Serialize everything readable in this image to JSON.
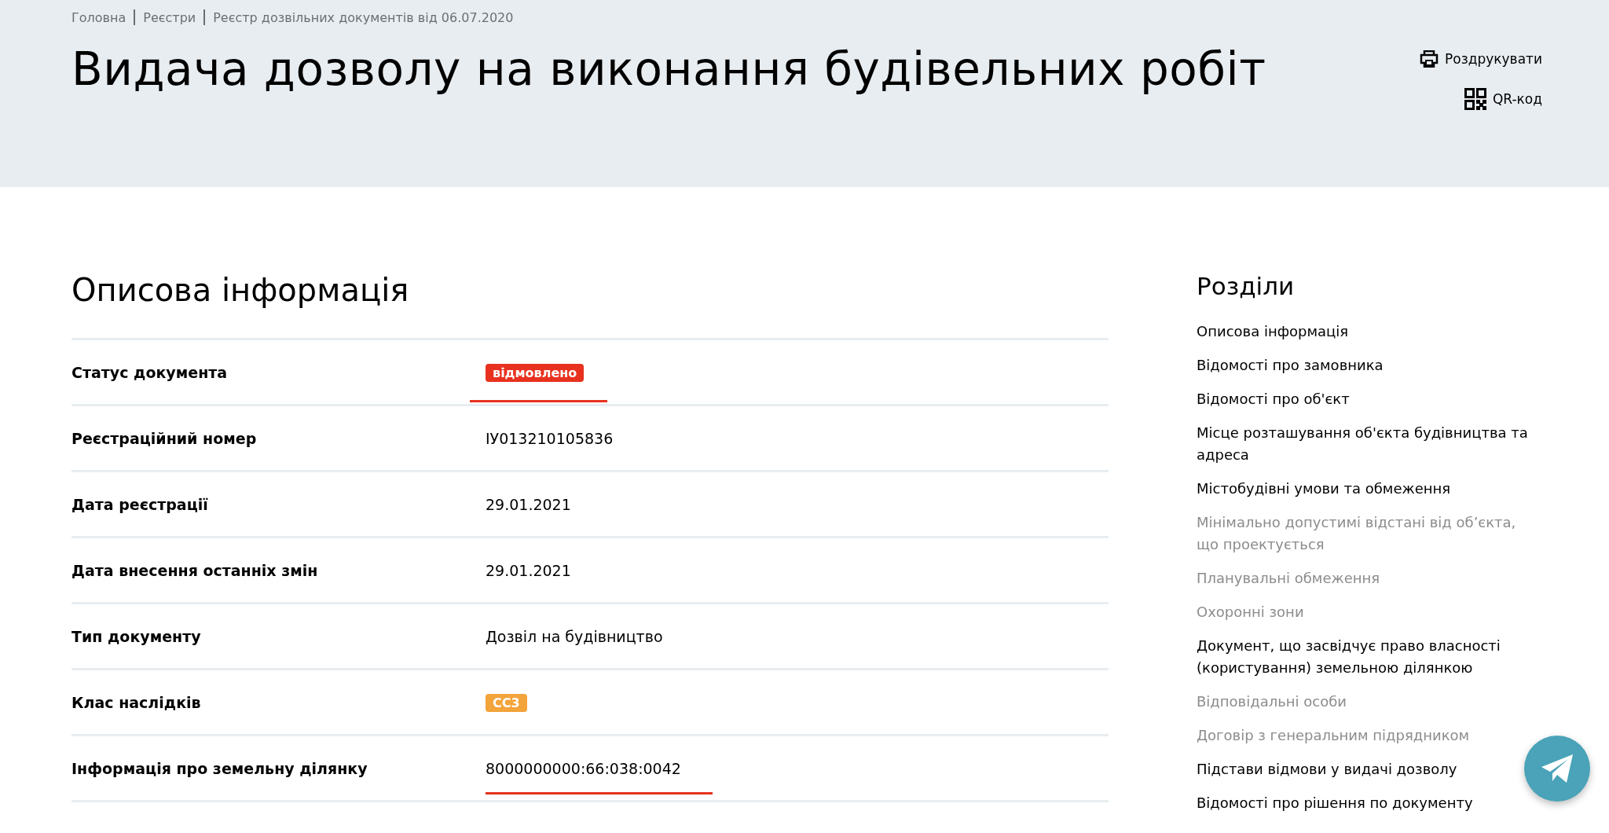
{
  "breadcrumbs": [
    "Головна",
    "Реєстри",
    "Реєстр дозвільних документів від 06.07.2020"
  ],
  "title": "Видача дозволу на виконання будівельних робіт",
  "actions": [
    {
      "kind": "print",
      "label": "Роздрукувати"
    },
    {
      "kind": "qr",
      "label": "QR-код"
    }
  ],
  "section": {
    "title": "Описова інформація",
    "rows": [
      {
        "label": "Статус документа",
        "kind": "badge",
        "value": "відмовлено",
        "color": "#e8321f",
        "underlined": true
      },
      {
        "label": "Реєстраційний номер",
        "kind": "text",
        "value": "ІУ013210105836",
        "underlined": false
      },
      {
        "label": "Дата реєстрації",
        "kind": "text",
        "value": "29.01.2021",
        "underlined": false
      },
      {
        "label": "Дата внесення останніх змін",
        "kind": "text",
        "value": "29.01.2021",
        "underlined": false
      },
      {
        "label": "Тип документу",
        "kind": "text",
        "value": "Дозвіл на будівництво",
        "underlined": false
      },
      {
        "label": "Клас наслідків",
        "kind": "badge",
        "value": "СС3",
        "color": "#f3a43b",
        "underlined": false
      },
      {
        "label": "Інформація про земельну ділянку",
        "kind": "text",
        "value": "8000000000:66:038:0042",
        "underlined": true
      }
    ]
  },
  "sidebar": {
    "title": "Розділи",
    "items": [
      {
        "label": "Описова інформація",
        "disabled": false
      },
      {
        "label": "Відомості про замовника",
        "disabled": false
      },
      {
        "label": "Відомості про об'єкт",
        "disabled": false
      },
      {
        "label": "Місце розташування об'єкта будівництва та адреса",
        "disabled": false
      },
      {
        "label": "Містобудівні умови та обмеження",
        "disabled": false
      },
      {
        "label": "Мінімально допустимі відстані від об’єкта, що проектується",
        "disabled": true
      },
      {
        "label": "Планувальні обмеження",
        "disabled": true
      },
      {
        "label": "Охоронні зони",
        "disabled": true
      },
      {
        "label": "Документ, що засвідчує право власності (користування) земельною ділянкою",
        "disabled": false
      },
      {
        "label": "Відповідальні особи",
        "disabled": true
      },
      {
        "label": "Договір з генеральним підрядником",
        "disabled": true
      },
      {
        "label": "Підстави відмови у видачі дозволу",
        "disabled": false
      },
      {
        "label": "Відомості про рішення по документу",
        "disabled": false
      }
    ]
  }
}
